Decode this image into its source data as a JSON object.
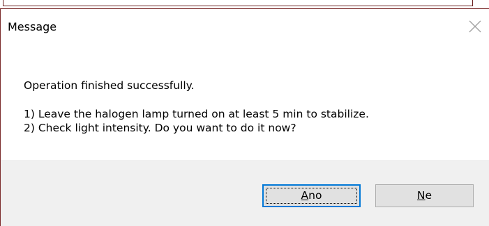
{
  "dialog": {
    "title": "Message",
    "close_icon": "close-icon",
    "message": {
      "line1": "Operation finished successfully.",
      "line2": "1) Leave the halogen lamp turned on at least 5 min to stabilize.",
      "line3": "2) Check light intensity. Do you want to do it now?"
    },
    "buttons": {
      "yes_mnemonic": "A",
      "yes_rest": "no",
      "no_mnemonic": "N",
      "no_rest": "e"
    }
  },
  "colors": {
    "footer_bg": "#f0f0f0",
    "button_bg": "#e1e1e1",
    "focus_border": "#0078d7",
    "window_border": "#7a2a2a"
  }
}
